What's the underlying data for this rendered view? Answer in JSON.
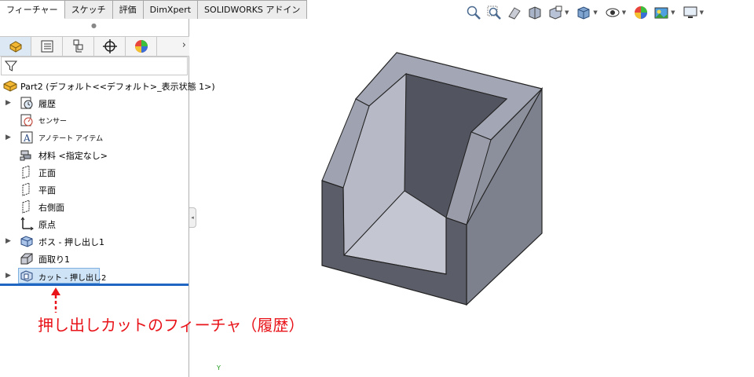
{
  "tabs": [
    {
      "label": "フィーチャー",
      "active": true
    },
    {
      "label": "スケッチ",
      "active": false
    },
    {
      "label": "評価",
      "active": false
    },
    {
      "label": "DimXpert",
      "active": false
    },
    {
      "label": "SOLIDWORKS アドイン",
      "active": false
    }
  ],
  "tree": {
    "root": "Part2 (デフォルト<<デフォルト>_表示状態 1>)",
    "items": [
      {
        "label": "履歴",
        "expandable": true,
        "icon": "history-icon"
      },
      {
        "label": "センサー",
        "expandable": false,
        "icon": "sensor-icon",
        "small": true
      },
      {
        "label": "アノテート アイテム",
        "expandable": true,
        "icon": "annotation-icon",
        "small": true
      },
      {
        "label": "材料 <指定なし>",
        "expandable": false,
        "icon": "material-icon"
      },
      {
        "label": "正面",
        "expandable": false,
        "icon": "plane-icon"
      },
      {
        "label": "平面",
        "expandable": false,
        "icon": "plane-icon"
      },
      {
        "label": "右側面",
        "expandable": false,
        "icon": "plane-icon"
      },
      {
        "label": "原点",
        "expandable": false,
        "icon": "origin-icon"
      },
      {
        "label": "ボス - 押し出し1",
        "expandable": true,
        "icon": "boss-extrude-icon"
      },
      {
        "label": "面取り1",
        "expandable": false,
        "icon": "chamfer-icon"
      },
      {
        "label": "カット - 押し出し2",
        "expandable": true,
        "icon": "cut-extrude-icon",
        "selected": true
      }
    ]
  },
  "annotation": {
    "text": "押し出しカットのフィーチャ（履歴）",
    "color": "#e8141a"
  },
  "triad": {
    "axis": "Y"
  },
  "colors": {
    "selection": "#cfe3f7",
    "rollback_bar": "#1f66c2",
    "model_front": "#5b5d68",
    "model_side": "#7d808d",
    "model_top": "#9a9caa"
  }
}
